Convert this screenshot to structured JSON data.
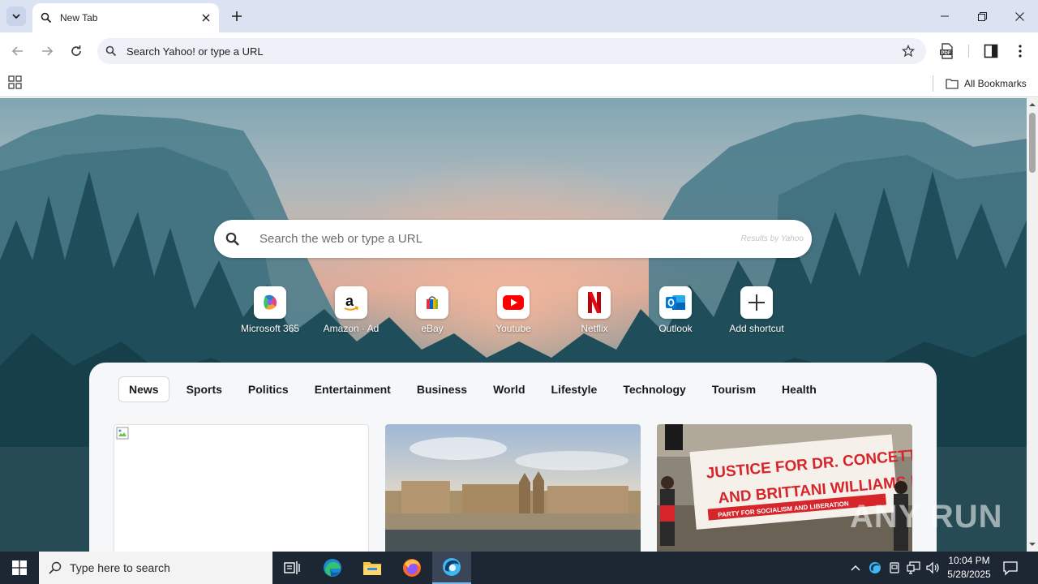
{
  "browser": {
    "tab": {
      "title": "New Tab"
    },
    "omnibox": {
      "placeholder": "Search Yahoo! or type a URL"
    },
    "bookmarks": {
      "all_label": "All Bookmarks"
    }
  },
  "newtab": {
    "search": {
      "placeholder": "Search the web or type a URL",
      "provider": "Results by Yahoo"
    },
    "shortcuts": [
      {
        "label": "Microsoft 365",
        "icon": "microsoft-365-icon"
      },
      {
        "label": "Amazon · Ad",
        "icon": "amazon-icon"
      },
      {
        "label": "eBay",
        "icon": "ebay-icon"
      },
      {
        "label": "Youtube",
        "icon": "youtube-icon"
      },
      {
        "label": "Netflix",
        "icon": "netflix-icon"
      },
      {
        "label": "Outlook",
        "icon": "outlook-icon"
      },
      {
        "label": "Add shortcut",
        "icon": "plus-icon"
      }
    ],
    "news_tabs": [
      "News",
      "Sports",
      "Politics",
      "Entertainment",
      "Business",
      "World",
      "Lifestyle",
      "Technology",
      "Tourism",
      "Health"
    ],
    "banner_text": [
      "JUSTICE FOR DR. CONCETTA MANNER",
      "AND BRITTANI WILLIAMS NOW!",
      "PARTY FOR SOCIALISM AND LIBERATION"
    ],
    "watermark": "ANY RUN"
  },
  "taskbar": {
    "search_placeholder": "Type here to search",
    "time": "10:04 PM",
    "date": "5/28/2025"
  },
  "colors": {
    "tabstrip": "#dbe3f3",
    "taskbar": "#1d2633",
    "accent": "#0b57d0"
  }
}
